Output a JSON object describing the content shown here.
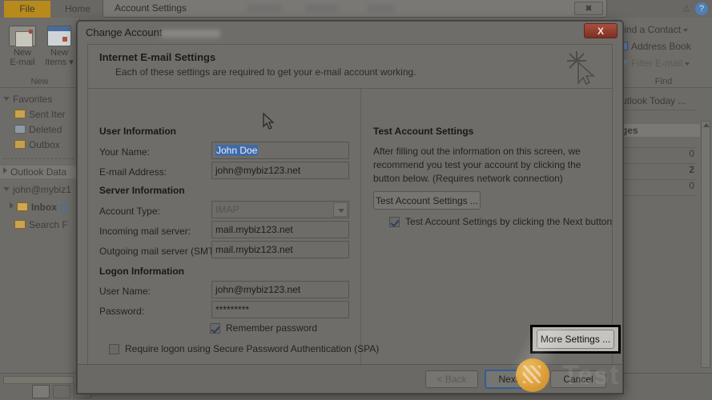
{
  "outlook": {
    "ribbon_tabs": [
      {
        "label": "File",
        "name": "file"
      },
      {
        "label": "Home",
        "name": "home"
      },
      {
        "label": "S",
        "name": "send-receive"
      }
    ],
    "ribbon_groups": [
      {
        "label": "New",
        "buttons": [
          {
            "line1": "New",
            "line2": "E-mail",
            "icon": "new-email-icon"
          },
          {
            "line1": "New",
            "line2": "Items ▾",
            "icon": "new-items-icon"
          }
        ]
      },
      {
        "label": "Find",
        "buttons": [
          {
            "label": "Find a Contact",
            "icon": "find-contact-icon"
          },
          {
            "label": "Address Book",
            "icon": "address-book-icon"
          },
          {
            "label": "Filter E-mail",
            "icon": "filter-email-icon"
          }
        ]
      }
    ],
    "help_icon": "?",
    "nav_pane": {
      "items": [
        {
          "label": "Favorites",
          "icon": "expand-triangle-icon"
        },
        {
          "label": "Sent Iter",
          "icon": "sent-items-folder-icon"
        },
        {
          "label": "Deleted",
          "icon": "deleted-items-folder-icon"
        },
        {
          "label": "Outbox",
          "icon": "outbox-folder-icon"
        },
        {
          "label": "Outlook Data",
          "icon": "collapse-triangle-icon"
        },
        {
          "label": "john@mybiz1",
          "icon": "expand-triangle-icon"
        },
        {
          "label": "Inbox",
          "count": "(1",
          "icon": "inbox-folder-icon"
        },
        {
          "label": "Search F",
          "icon": "search-folder-icon"
        }
      ]
    },
    "reading_pane": {
      "title": "utlook Today ...",
      "section_header": "ges",
      "values": [
        "0",
        "2",
        "0"
      ]
    }
  },
  "account_settings_window": {
    "title": "Account Settings",
    "close_label": "✖"
  },
  "dialog": {
    "title": "Change Account",
    "close_label": "X",
    "header": {
      "heading": "Internet E-mail Settings",
      "subtext": "Each of these settings are required to get your e-mail account working.",
      "icon": "wand-cursor-icon"
    },
    "user_information": {
      "heading": "User Information",
      "fields": [
        {
          "label": "Your Name:",
          "value": "John Doe",
          "selected": true
        },
        {
          "label": "E-mail Address:",
          "value": "john@mybiz123.net",
          "selected": false
        }
      ]
    },
    "server_information": {
      "heading": "Server Information",
      "account_type": {
        "label": "Account Type:",
        "value": "IMAP",
        "disabled": true
      },
      "fields": [
        {
          "label": "Incoming mail server:",
          "value": "mail.mybiz123.net"
        },
        {
          "label": "Outgoing mail server (SMTP):",
          "value": "mail.mybiz123.net"
        }
      ]
    },
    "logon_information": {
      "heading": "Logon Information",
      "fields": [
        {
          "label": "User Name:",
          "value": "john@mybiz123.net"
        },
        {
          "label": "Password:",
          "value": "*********"
        }
      ],
      "remember_password": {
        "label": "Remember password",
        "checked": true
      },
      "spa": {
        "label": "Require logon using Secure Password Authentication (SPA)",
        "checked": false
      }
    },
    "test_account": {
      "heading": "Test Account Settings",
      "description": "After filling out the information on this screen, we recommend you test your account by clicking the button below. (Requires network connection)",
      "button_label": "Test Account Settings ...",
      "checkbox": {
        "label": "Test Account Settings by clicking the Next button",
        "checked": true
      }
    },
    "more_settings_label": "More Settings ...",
    "footer_buttons": [
      {
        "label": "< Back",
        "state": "disabled"
      },
      {
        "label": "Next >",
        "state": "focused"
      },
      {
        "label": "Cancel",
        "state": "normal"
      }
    ]
  },
  "watermark": {
    "text": "Test"
  },
  "colors": {
    "accent_file_tab": "#b78a1b",
    "dialog_close_red": "#a8503e",
    "selection_blue": "#3f6aa8",
    "focus_ring_blue": "#2f5f93",
    "watermark_orange": "#e8a437"
  }
}
